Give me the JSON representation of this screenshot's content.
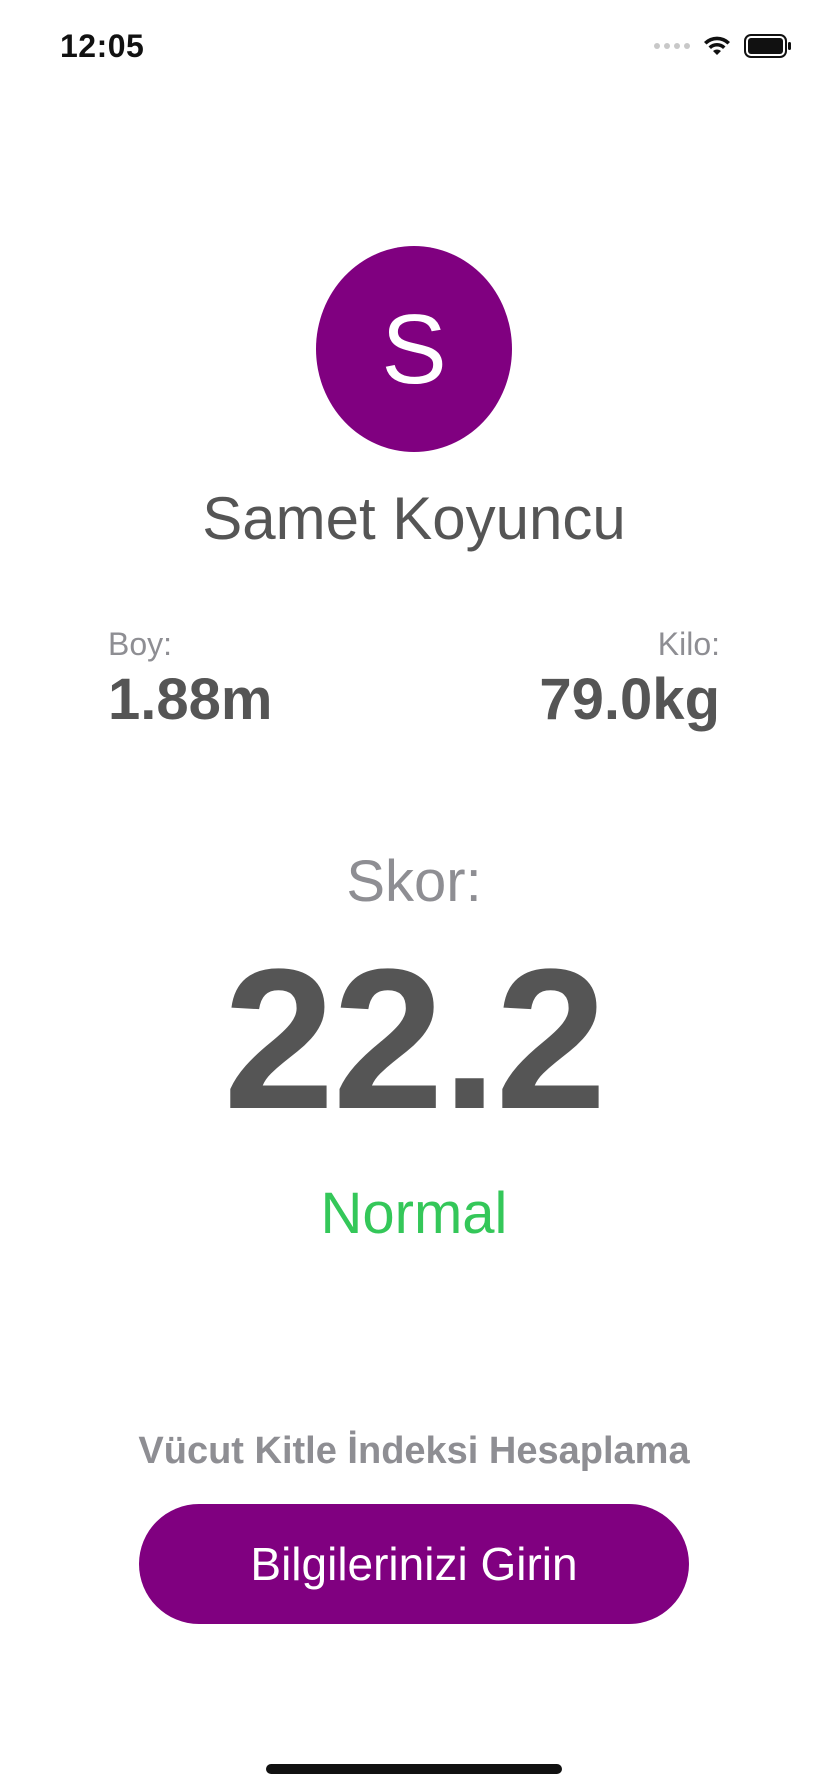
{
  "status_bar": {
    "time": "12:05",
    "icons": [
      "cellular-signal-icon",
      "wifi-icon",
      "battery-icon"
    ]
  },
  "profile": {
    "avatar_initial": "S",
    "name": "Samet Koyuncu"
  },
  "stats": {
    "height_label": "Boy:",
    "height_value": "1.88m",
    "weight_label": "Kilo:",
    "weight_value": "79.0kg"
  },
  "score": {
    "label": "Skor:",
    "value": "22.2",
    "result": "Normal"
  },
  "footer": {
    "title": "Vücut Kitle İndeksi Hesaplama",
    "button_label": "Bilgilerinizi Girin"
  },
  "colors": {
    "accent": "#800080",
    "status_normal": "#34c759",
    "primary_text": "#555555",
    "secondary_text": "#8e8e93"
  }
}
